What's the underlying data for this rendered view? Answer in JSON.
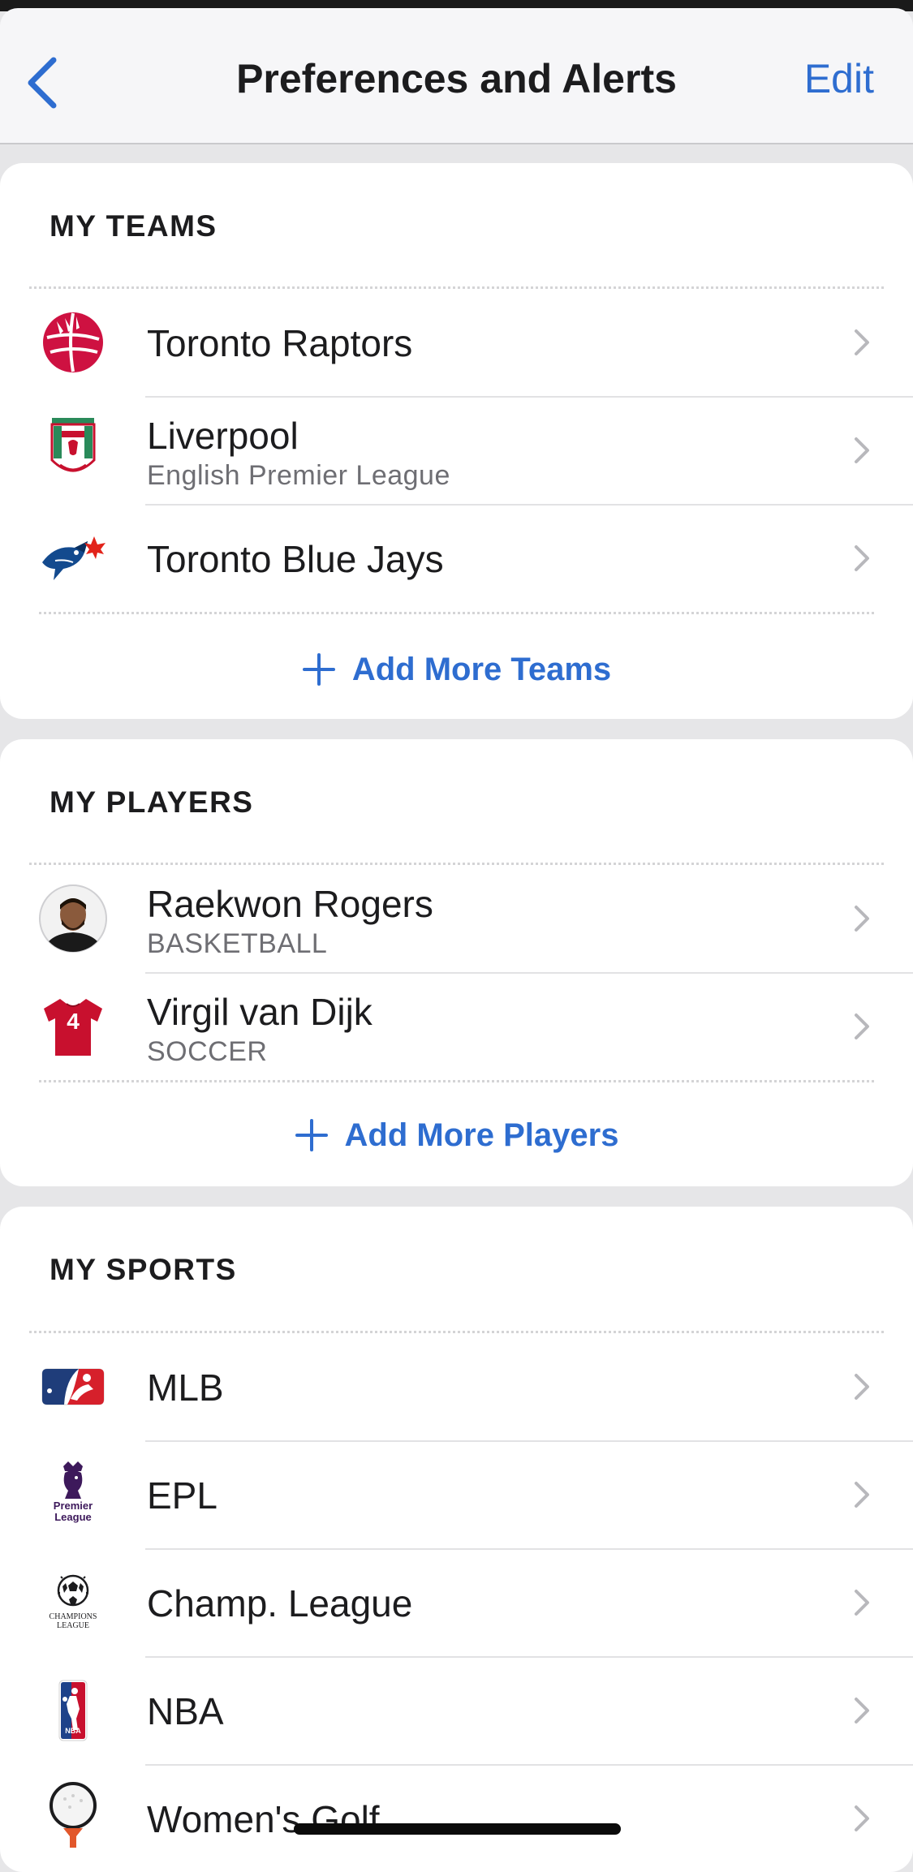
{
  "nav": {
    "title": "Preferences and Alerts",
    "edit_label": "Edit"
  },
  "teams": {
    "header": "MY TEAMS",
    "items": [
      {
        "name": "Toronto Raptors",
        "subtitle": "",
        "icon": "raptors-logo-icon"
      },
      {
        "name": "Liverpool",
        "subtitle": "English Premier League",
        "icon": "liverpool-crest-icon"
      },
      {
        "name": "Toronto Blue Jays",
        "subtitle": "",
        "icon": "blue-jays-logo-icon"
      }
    ],
    "add_label": "Add More Teams"
  },
  "players": {
    "header": "MY PLAYERS",
    "items": [
      {
        "name": "Raekwon Rogers",
        "subtitle": "BASKETBALL",
        "icon": "player-headshot-icon"
      },
      {
        "name": "Virgil van Dijk",
        "subtitle": "SOCCER",
        "icon": "jersey-icon",
        "jersey_number": "4"
      }
    ],
    "add_label": "Add More Players"
  },
  "sports": {
    "header": "MY SPORTS",
    "items": [
      {
        "name": "MLB",
        "icon": "mlb-logo-icon"
      },
      {
        "name": "EPL",
        "icon": "premier-league-logo-icon",
        "logo_text": "Premier League"
      },
      {
        "name": "Champ. League",
        "icon": "champions-league-logo-icon",
        "logo_text": "CHAMPIONS LEAGUE"
      },
      {
        "name": "NBA",
        "icon": "nba-logo-icon",
        "logo_text": "NBA"
      },
      {
        "name": "Women's Golf",
        "icon": "golf-ball-icon"
      }
    ]
  },
  "colors": {
    "accent": "#2e6dd0",
    "raptors_red": "#ce1141",
    "liverpool_red": "#c8102e",
    "bluejays_blue": "#134a8e",
    "premier_purple": "#3d195b"
  }
}
